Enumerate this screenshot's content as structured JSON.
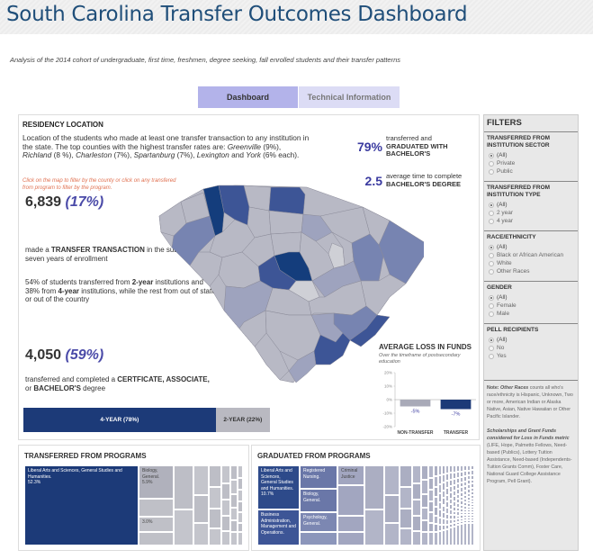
{
  "header": {
    "title": "South Carolina Transfer Outcomes Dashboard"
  },
  "subtitle": "Analysis of the 2014 cohort of undergraduate, first time, freshmen, degree seeking, fall enrolled students and their transfer patterns",
  "tabs": [
    {
      "label": "Dashboard",
      "active": true
    },
    {
      "label": "Technical Information",
      "active": false
    }
  ],
  "residency": {
    "title": "RESIDENCY LOCATION",
    "desc_intro": "Location of the students who made at least one transfer transaction to any institution in the state. The top counties with the highest transfer rates are: ",
    "counties": [
      {
        "name": "Greenville",
        "pct": "(9%)"
      },
      {
        "name": "Richland",
        "pct": "(8 %)"
      },
      {
        "name": "Charleston",
        "pct": "(7%)"
      },
      {
        "name": "Spartanburg",
        "pct": "(7%)"
      },
      {
        "name": "Lexington",
        "pct": ""
      },
      {
        "name": "York",
        "pct": "(6% each)."
      }
    ],
    "hint": "Click on the map to filter by the county or click on any transfered from program to filter by the program."
  },
  "stats": {
    "transfer_count": "6,839",
    "transfer_pct": "(17%)",
    "transfer_text_pre": "made a ",
    "transfer_text_bold": "TRANSFER TRANSACTION",
    "transfer_text_post": " in the subsequent seven years of enrollment",
    "origin_p1": "54% of students transferred from ",
    "origin_b1": "2-year",
    "origin_p2": " institutions and 38% from ",
    "origin_b2": "4-year",
    "origin_p3": " institutions, while the rest from out of state or out of the country",
    "completed_count": "4,050",
    "completed_pct": "(59%)",
    "completed_pre": "transferred and completed a ",
    "completed_bold1": "CERTFICATE, ASSOCIATE,",
    "completed_mid": " or ",
    "completed_bold2": "BACHELOR'S",
    "completed_post": " degree",
    "bar": [
      {
        "label": "4-YEAR (78%)",
        "value": 78,
        "color": "#1c3a78"
      },
      {
        "label": "2-YEAR (22%)",
        "value": 22,
        "color": "#b9b9c1"
      }
    ]
  },
  "kpis": [
    {
      "value": "79%",
      "text_pre": "transferred and ",
      "text_bold": "GRADUATED WITH BACHELOR'S",
      "text_post": ""
    },
    {
      "value": "2.5",
      "text_pre": "average time to complete ",
      "text_bold": "BACHELOR'S DEGREE",
      "text_post": ""
    }
  ],
  "map": {
    "colors": {
      "darkest": "#143d7c",
      "dark": "#3d5596",
      "medium": "#7784b1",
      "light": "#9ea3be",
      "base": "#b8b9c5",
      "lightest": "#cfd0d6"
    }
  },
  "chart_data": {
    "type": "bar",
    "title": "AVERAGE LOSS IN FUNDS",
    "subtitle": "Over the timeframe of postsecondary education",
    "categories": [
      "NON-TRANSFER",
      "TRANSFER"
    ],
    "values": [
      -5,
      -7
    ],
    "data_labels": [
      "-5%",
      "-7%"
    ],
    "colors": [
      "#a9aab8",
      "#1c3a78"
    ],
    "yticks": [
      "20%",
      "10%",
      "0%",
      "-10%",
      "-20%"
    ],
    "ytick_values": [
      20,
      10,
      0,
      -10,
      -20
    ],
    "ylim": [
      -20,
      20
    ],
    "xlabel": "",
    "ylabel": ""
  },
  "filters": {
    "title": "FILTERS",
    "groups": [
      {
        "title": "TRANSFERRED FROM INSTITUTION SECTOR",
        "options": [
          "(All)",
          "Private",
          "Public"
        ],
        "selected": 0
      },
      {
        "title": "TRANSFERRED FROM INSTITUTION TYPE",
        "options": [
          "(All)",
          "2 year",
          "4 year"
        ],
        "selected": 0
      },
      {
        "title": "RACE/ETHNICITY",
        "options": [
          "(All)",
          "Black or African American",
          "White",
          "Other Races"
        ],
        "selected": 0
      },
      {
        "title": "GENDER",
        "options": [
          "(All)",
          "Female",
          "Male"
        ],
        "selected": 0
      },
      {
        "title": "PELL RECIPIENTS",
        "options": [
          "(All)",
          "No",
          "Yes"
        ],
        "selected": 0
      }
    ],
    "note1_label": "Note: ",
    "note1_bold": "Other Races",
    "note1_text": " counts all who's race/ethnicity is Hispanic, Unknown, Two or more, American Indian or Alaska Native, Asian, Native Hawaiian or Other Pacific Islander.",
    "note2_bold": "Scholarships and Grant Funds considered for Loss in Funds metric",
    "note2_text": " (LIFE, Hope, Palmetto Fellows, Need-based (Publics), Lottery Tuition Assistance, Need-based (Independents-Tuition Grants Comm), Foster Care, National Guard College Assistance Program, Pell Grant)."
  },
  "transferred_programs": {
    "title": "TRANSFERRED FROM PROGRAMS",
    "items": [
      {
        "label": "Liberal Arts and Sciences, General Studies and Humanities.",
        "value": "52.3%"
      },
      {
        "label": "Biology, General.",
        "value": "5.9%"
      },
      {
        "label": "",
        "value": "3.0%"
      }
    ]
  },
  "graduated_programs": {
    "title": "GRADUATED FROM PROGRAMS",
    "items": [
      {
        "label": "Liberal Arts and Sciences, General Studies and Humanities.",
        "value": "10.7%"
      },
      {
        "label": "Business Administration, Management and Operations.",
        "value": ""
      },
      {
        "label": "Registered Nursing.",
        "value": ""
      },
      {
        "label": "Biology, General.",
        "value": ""
      },
      {
        "label": "Psychology, General.",
        "value": ""
      },
      {
        "label": "Criminal Justice",
        "value": ""
      }
    ]
  }
}
